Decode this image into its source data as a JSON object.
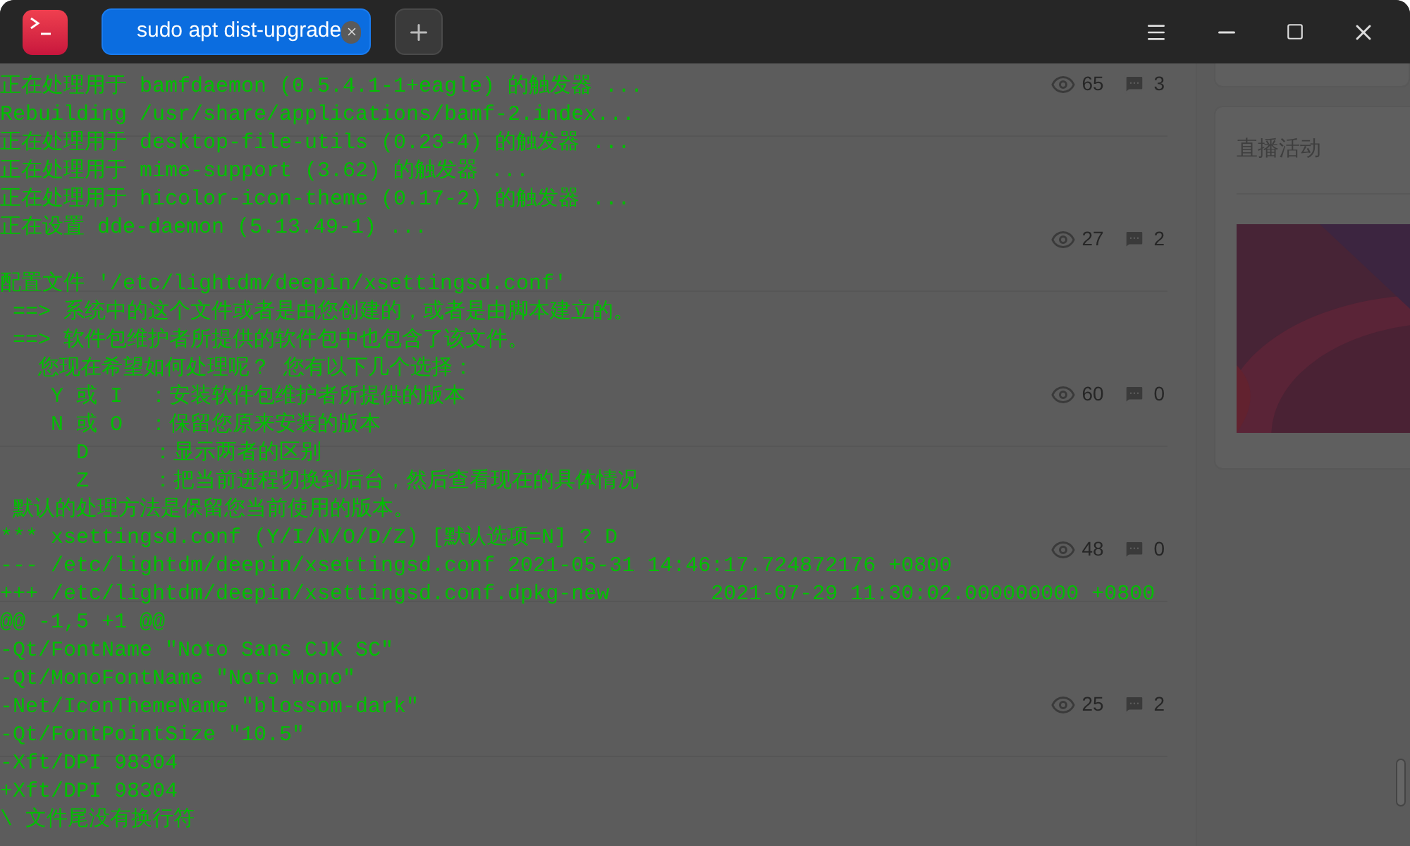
{
  "tab": {
    "title": "sudo apt dist-upgrade",
    "selected": true
  },
  "background_page": {
    "rows": [
      {
        "meta": [],
        "views": "65",
        "comments": "3"
      },
      {
        "meta": [],
        "views": "27",
        "comments": "2"
      },
      {
        "meta": [],
        "views": "60",
        "comments": "0"
      },
      {
        "meta": [],
        "views": "48",
        "comments": "0"
      },
      {
        "meta": [],
        "views": "25",
        "comments": "2"
      }
    ],
    "side_card": {
      "title": "直播活动"
    }
  },
  "terminal": {
    "blocks": [
      {
        "lines": [
          "正在处理用于 bamfdaemon (0.5.4.1-1+eagle) 的触发器 ...",
          "Rebuilding /usr/share/applications/bamf-2.index...",
          "正在处理用于 desktop-file-utils (0.23-4) 的触发器 ...",
          "正在处理用于 mime-support (3.62) 的触发器 ...",
          "正在处理用于 hicolor-icon-theme (0.17-2) 的触发器 ...",
          "正在设置 dde-daemon (5.13.49-1) ..."
        ]
      },
      {
        "lines": [
          "配置文件 '/etc/lightdm/deepin/xsettingsd.conf'",
          " ==> 系统中的这个文件或者是由您创建的，或者是由脚本建立的。",
          " ==> 软件包维护者所提供的软件包中也包含了该文件。",
          "   您现在希望如何处理呢？ 您有以下几个选择：",
          "    Y 或 I  ：安装软件包维护者所提供的版本",
          "    N 或 O  ：保留您原来安装的版本",
          "      D     ：显示两者的区别",
          "      Z     ：把当前进程切换到后台，然后查看现在的具体情况",
          " 默认的处理方法是保留您当前使用的版本。",
          "*** xsettingsd.conf (Y/I/N/O/D/Z) [默认选项=N] ? D",
          "--- /etc/lightdm/deepin/xsettingsd.conf 2021-05-31 14:46:17.724872176 +0800",
          "+++ /etc/lightdm/deepin/xsettingsd.conf.dpkg-new        2021-07-29 11:30:02.000000000 +0800",
          "@@ -1,5 +1 @@",
          "-Qt/FontName \"Noto Sans CJK SC\"",
          "-Qt/MonoFontName \"Noto Mono\"",
          "-Net/IconThemeName \"blossom-dark\"",
          "-Qt/FontPointSize \"10.5\"",
          "-Xft/DPI 98304",
          "+Xft/DPI 98304",
          "\\ 文件尾没有换行符"
        ]
      }
    ]
  }
}
